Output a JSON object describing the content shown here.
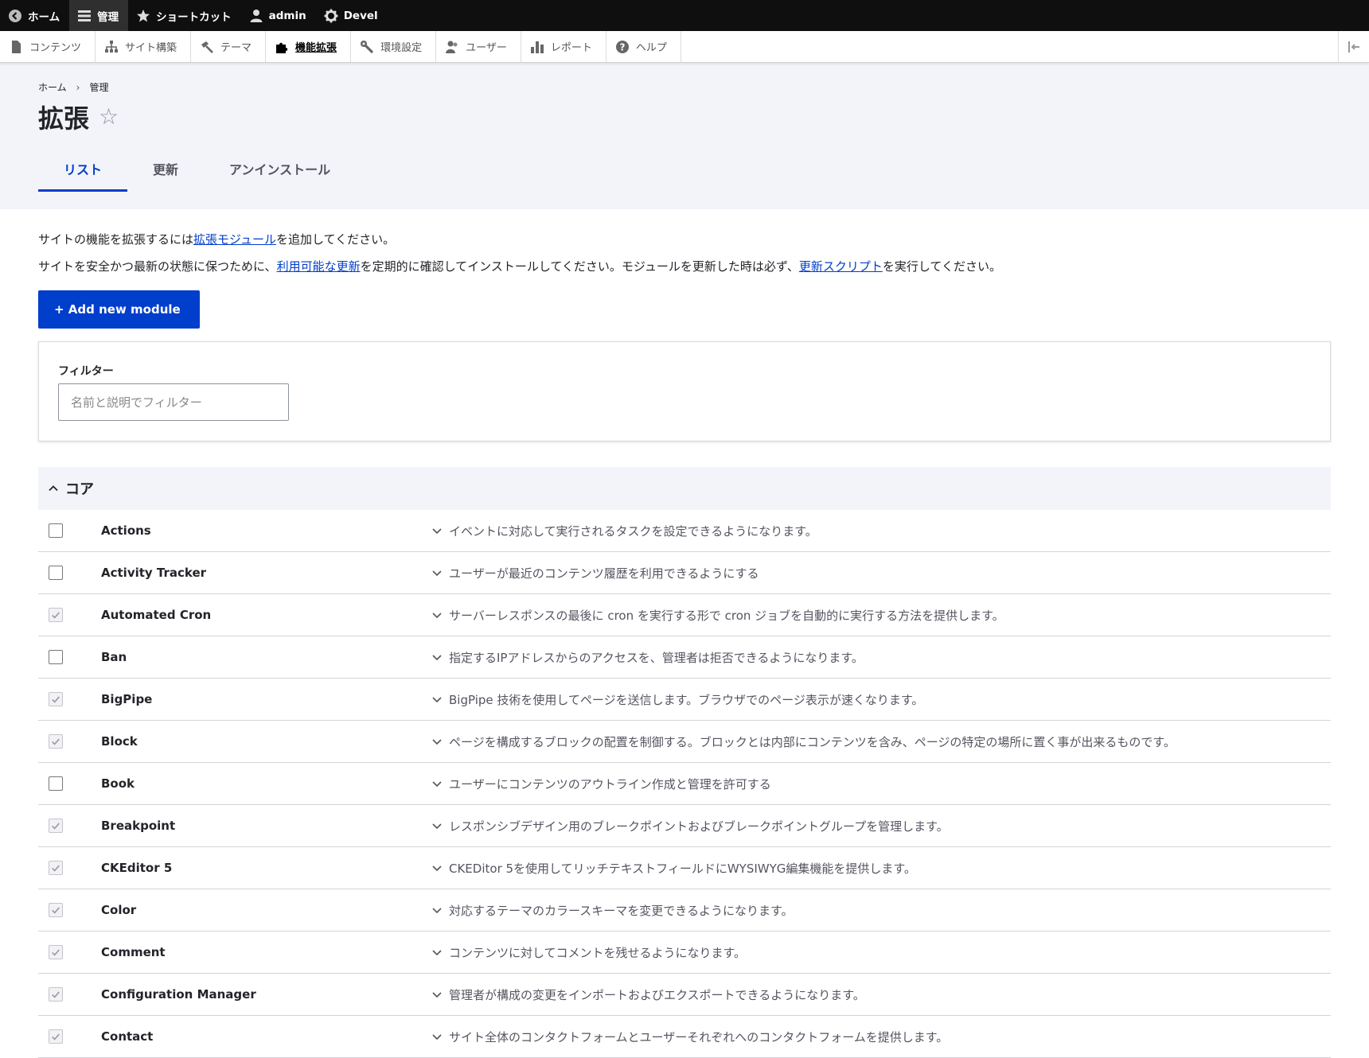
{
  "toolbar": {
    "home": "ホーム",
    "manage": "管理",
    "shortcuts": "ショートカット",
    "user": "admin",
    "devel": "Devel"
  },
  "tray": {
    "content": "コンテンツ",
    "structure": "サイト構築",
    "appearance": "テーマ",
    "extend": "機能拡張",
    "config": "環境設定",
    "people": "ユーザー",
    "reports": "レポート",
    "help": "ヘルプ"
  },
  "breadcrumb": {
    "home": "ホーム",
    "sep": "›",
    "manage": "管理"
  },
  "page_title": "拡張",
  "tabs": {
    "list": "リスト",
    "update": "更新",
    "uninstall": "アンインストール"
  },
  "intro": {
    "line1_before": "サイトの機能を拡張するには",
    "line1_link": "拡張モジュール",
    "line1_after": "を追加してください。",
    "line2_before": "サイトを安全かつ最新の状態に保つために、",
    "line2_link1": "利用可能な更新",
    "line2_middle": "を定期的に確認してインストールしてください。モジュールを更新した時は必ず、",
    "line2_link2": "更新スクリプト",
    "line2_after": "を実行してください。"
  },
  "add_button": "+ Add new module",
  "filter": {
    "label": "フィルター",
    "placeholder": "名前と説明でフィルター",
    "value": ""
  },
  "section": {
    "title": "コア"
  },
  "modules": [
    {
      "name": "Actions",
      "checked": false,
      "desc": "イベントに対応して実行されるタスクを設定できるようになります。"
    },
    {
      "name": "Activity Tracker",
      "checked": false,
      "desc": "ユーザーが最近のコンテンツ履歴を利用できるようにする"
    },
    {
      "name": "Automated Cron",
      "checked": true,
      "desc": "サーバーレスポンスの最後に cron を実行する形で cron ジョブを自動的に実行する方法を提供します。"
    },
    {
      "name": "Ban",
      "checked": false,
      "desc": "指定するIPアドレスからのアクセスを、管理者は拒否できるようになります。"
    },
    {
      "name": "BigPipe",
      "checked": true,
      "desc": "BigPipe 技術を使用してページを送信します。ブラウザでのページ表示が速くなります。"
    },
    {
      "name": "Block",
      "checked": true,
      "desc": "ページを構成するブロックの配置を制御する。ブロックとは内部にコンテンツを含み、ページの特定の場所に置く事が出来るものです。"
    },
    {
      "name": "Book",
      "checked": false,
      "desc": "ユーザーにコンテンツのアウトライン作成と管理を許可する"
    },
    {
      "name": "Breakpoint",
      "checked": true,
      "desc": "レスポンシブデザイン用のブレークポイントおよびブレークポイントグループを管理します。"
    },
    {
      "name": "CKEditor 5",
      "checked": true,
      "desc": "CKEDitor 5を使用してリッチテキストフィールドにWYSIWYG編集機能を提供します。"
    },
    {
      "name": "Color",
      "checked": true,
      "desc": "対応するテーマのカラースキーマを変更できるようになります。"
    },
    {
      "name": "Comment",
      "checked": true,
      "desc": "コンテンツに対してコメントを残せるようになります。"
    },
    {
      "name": "Configuration Manager",
      "checked": true,
      "desc": "管理者が構成の変更をインポートおよびエクスポートできるようになります。"
    },
    {
      "name": "Contact",
      "checked": true,
      "desc": "サイト全体のコンタクトフォームとユーザーそれぞれへのコンタクトフォームを提供します。"
    }
  ]
}
